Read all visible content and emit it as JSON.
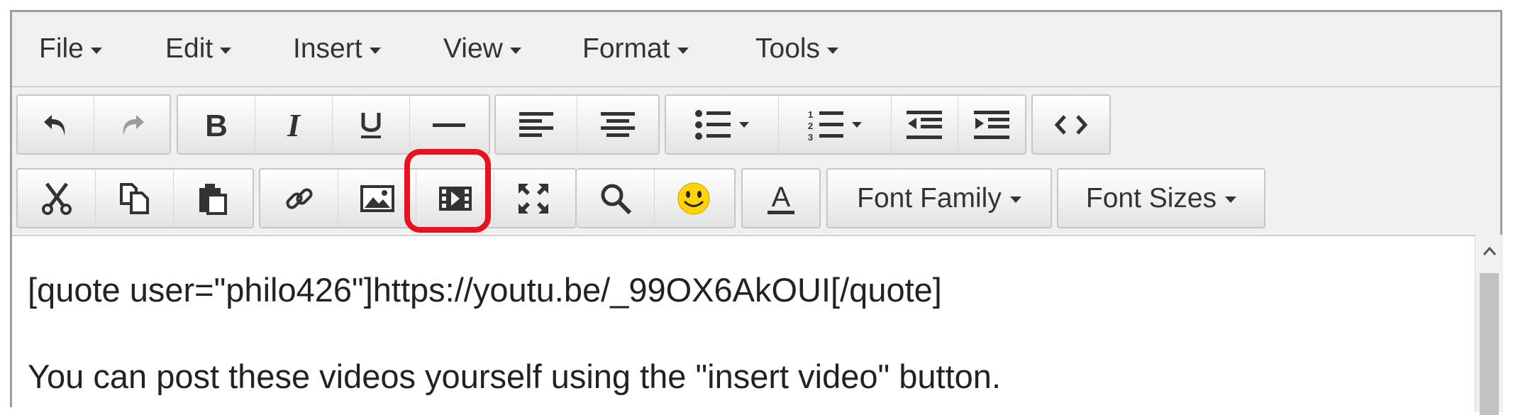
{
  "menubar": {
    "items": [
      {
        "label": "File"
      },
      {
        "label": "Edit"
      },
      {
        "label": "Insert"
      },
      {
        "label": "View"
      },
      {
        "label": "Format"
      },
      {
        "label": "Tools"
      }
    ]
  },
  "toolbar": {
    "font_family_label": "Font Family",
    "font_sizes_label": "Font Sizes"
  },
  "content": {
    "lines": [
      "[quote user=\"philo426\"]https://youtu.be/_99OX6AkOUI[/quote]",
      "You can post these videos yourself using the \"insert video\" button."
    ]
  },
  "annotation": {
    "highlight_color": "#e8121f",
    "highlighted_button": "insert-video-button"
  }
}
